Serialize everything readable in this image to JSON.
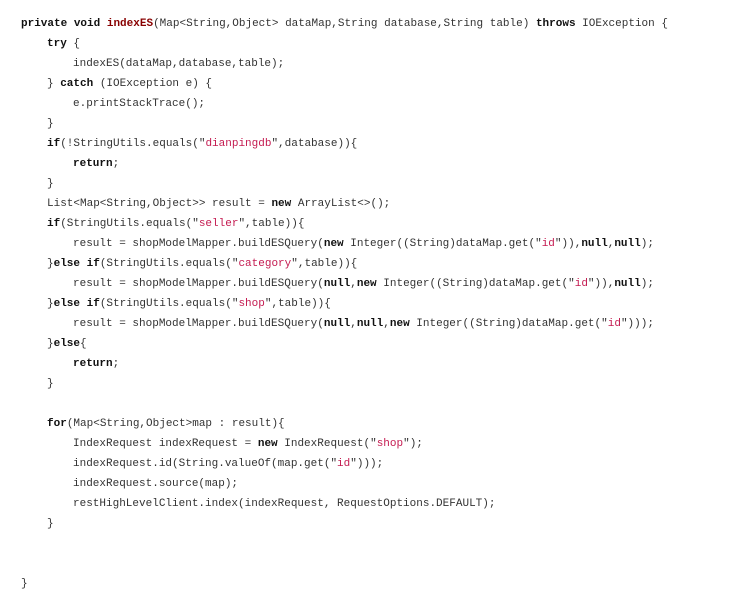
{
  "colors": {
    "text": "#333333",
    "keyword": "#111111",
    "function_name": "#880000",
    "string": "#c41a50"
  },
  "lines": [
    {
      "indent": 0,
      "tokens": [
        {
          "c": "k",
          "t": "private"
        },
        {
          "c": "",
          "t": " "
        },
        {
          "c": "k",
          "t": "void"
        },
        {
          "c": "",
          "t": " "
        },
        {
          "c": "f",
          "t": "indexES"
        },
        {
          "c": "",
          "t": "(Map<String,Object> dataMap,String database,String table) "
        },
        {
          "c": "k",
          "t": "throws"
        },
        {
          "c": "",
          "t": " IOException {"
        }
      ]
    },
    {
      "indent": 1,
      "tokens": [
        {
          "c": "k",
          "t": "try"
        },
        {
          "c": "",
          "t": " {"
        }
      ]
    },
    {
      "indent": 2,
      "tokens": [
        {
          "c": "",
          "t": "indexES(dataMap,database,table);"
        }
      ]
    },
    {
      "indent": 1,
      "tokens": [
        {
          "c": "",
          "t": "} "
        },
        {
          "c": "k",
          "t": "catch"
        },
        {
          "c": "",
          "t": " (IOException e) {"
        }
      ]
    },
    {
      "indent": 2,
      "tokens": [
        {
          "c": "",
          "t": "e.printStackTrace();"
        }
      ]
    },
    {
      "indent": 1,
      "tokens": [
        {
          "c": "",
          "t": "}"
        }
      ]
    },
    {
      "indent": 1,
      "tokens": [
        {
          "c": "k",
          "t": "if"
        },
        {
          "c": "",
          "t": "(!StringUtils.equals(\""
        },
        {
          "c": "s",
          "t": "dianpingdb"
        },
        {
          "c": "",
          "t": "\",database)){"
        }
      ]
    },
    {
      "indent": 2,
      "tokens": [
        {
          "c": "k",
          "t": "return"
        },
        {
          "c": "",
          "t": ";"
        }
      ]
    },
    {
      "indent": 1,
      "tokens": [
        {
          "c": "",
          "t": "}"
        }
      ]
    },
    {
      "indent": 1,
      "tokens": [
        {
          "c": "",
          "t": "List<Map<String,Object>> result = "
        },
        {
          "c": "k",
          "t": "new"
        },
        {
          "c": "",
          "t": " ArrayList<>();"
        }
      ]
    },
    {
      "indent": 1,
      "tokens": [
        {
          "c": "k",
          "t": "if"
        },
        {
          "c": "",
          "t": "(StringUtils.equals(\""
        },
        {
          "c": "s",
          "t": "seller"
        },
        {
          "c": "",
          "t": "\",table)){"
        }
      ]
    },
    {
      "indent": 2,
      "tokens": [
        {
          "c": "",
          "t": "result = shopModelMapper.buildESQuery("
        },
        {
          "c": "k",
          "t": "new"
        },
        {
          "c": "",
          "t": " Integer((String)dataMap.get(\""
        },
        {
          "c": "s",
          "t": "id"
        },
        {
          "c": "",
          "t": "\")),"
        },
        {
          "c": "k",
          "t": "null"
        },
        {
          "c": "",
          "t": ","
        },
        {
          "c": "k",
          "t": "null"
        },
        {
          "c": "",
          "t": ");"
        }
      ]
    },
    {
      "indent": 1,
      "tokens": [
        {
          "c": "",
          "t": "}"
        },
        {
          "c": "k",
          "t": "else"
        },
        {
          "c": "",
          "t": " "
        },
        {
          "c": "k",
          "t": "if"
        },
        {
          "c": "",
          "t": "(StringUtils.equals(\""
        },
        {
          "c": "s",
          "t": "category"
        },
        {
          "c": "",
          "t": "\",table)){"
        }
      ]
    },
    {
      "indent": 2,
      "tokens": [
        {
          "c": "",
          "t": "result = shopModelMapper.buildESQuery("
        },
        {
          "c": "k",
          "t": "null"
        },
        {
          "c": "",
          "t": ","
        },
        {
          "c": "k",
          "t": "new"
        },
        {
          "c": "",
          "t": " Integer((String)dataMap.get(\""
        },
        {
          "c": "s",
          "t": "id"
        },
        {
          "c": "",
          "t": "\")),"
        },
        {
          "c": "k",
          "t": "null"
        },
        {
          "c": "",
          "t": ");"
        }
      ]
    },
    {
      "indent": 1,
      "tokens": [
        {
          "c": "",
          "t": "}"
        },
        {
          "c": "k",
          "t": "else"
        },
        {
          "c": "",
          "t": " "
        },
        {
          "c": "k",
          "t": "if"
        },
        {
          "c": "",
          "t": "(StringUtils.equals(\""
        },
        {
          "c": "s",
          "t": "shop"
        },
        {
          "c": "",
          "t": "\",table)){"
        }
      ]
    },
    {
      "indent": 2,
      "tokens": [
        {
          "c": "",
          "t": "result = shopModelMapper.buildESQuery("
        },
        {
          "c": "k",
          "t": "null"
        },
        {
          "c": "",
          "t": ","
        },
        {
          "c": "k",
          "t": "null"
        },
        {
          "c": "",
          "t": ","
        },
        {
          "c": "k",
          "t": "new"
        },
        {
          "c": "",
          "t": " Integer((String)dataMap.get(\""
        },
        {
          "c": "s",
          "t": "id"
        },
        {
          "c": "",
          "t": "\")));"
        }
      ]
    },
    {
      "indent": 1,
      "tokens": [
        {
          "c": "",
          "t": "}"
        },
        {
          "c": "k",
          "t": "else"
        },
        {
          "c": "",
          "t": "{"
        }
      ]
    },
    {
      "indent": 2,
      "tokens": [
        {
          "c": "k",
          "t": "return"
        },
        {
          "c": "",
          "t": ";"
        }
      ]
    },
    {
      "indent": 1,
      "tokens": [
        {
          "c": "",
          "t": "}"
        }
      ]
    },
    {
      "indent": 0,
      "tokens": []
    },
    {
      "indent": 1,
      "tokens": [
        {
          "c": "k",
          "t": "for"
        },
        {
          "c": "",
          "t": "(Map<String,Object>map : result){"
        }
      ]
    },
    {
      "indent": 2,
      "tokens": [
        {
          "c": "",
          "t": "IndexRequest indexRequest = "
        },
        {
          "c": "k",
          "t": "new"
        },
        {
          "c": "",
          "t": " IndexRequest(\""
        },
        {
          "c": "s",
          "t": "shop"
        },
        {
          "c": "",
          "t": "\");"
        }
      ]
    },
    {
      "indent": 2,
      "tokens": [
        {
          "c": "",
          "t": "indexRequest.id(String.valueOf(map.get(\""
        },
        {
          "c": "s",
          "t": "id"
        },
        {
          "c": "",
          "t": "\")));"
        }
      ]
    },
    {
      "indent": 2,
      "tokens": [
        {
          "c": "",
          "t": "indexRequest.source(map);"
        }
      ]
    },
    {
      "indent": 2,
      "tokens": [
        {
          "c": "",
          "t": "restHighLevelClient.index(indexRequest, RequestOptions.DEFAULT);"
        }
      ]
    },
    {
      "indent": 1,
      "tokens": [
        {
          "c": "",
          "t": "}"
        }
      ]
    },
    {
      "indent": 0,
      "tokens": []
    },
    {
      "indent": 0,
      "tokens": []
    },
    {
      "indent": 0,
      "tokens": [
        {
          "c": "",
          "t": "}"
        }
      ]
    }
  ]
}
